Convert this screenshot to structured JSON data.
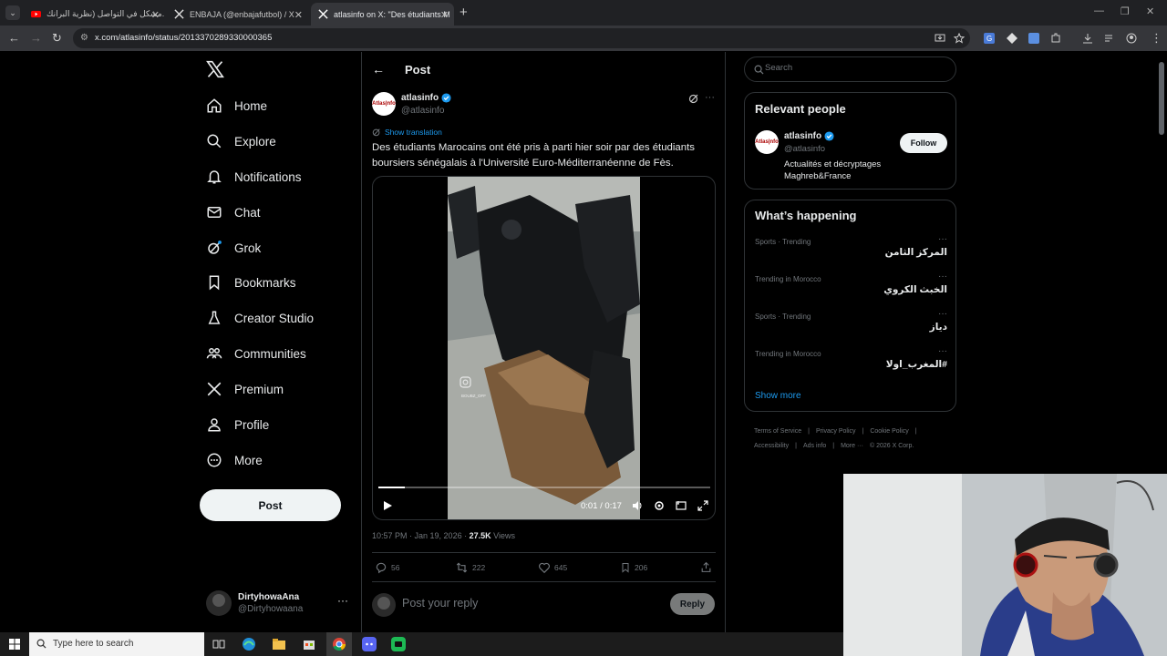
{
  "browser": {
    "tabs": [
      {
        "title": "مشكل في التواصل (نظرية البرانك...",
        "active": false
      },
      {
        "title": "ENBAJA (@enbajafutbol) / X",
        "active": false
      },
      {
        "title": "atlasinfo on X: \"Des étudiants M",
        "active": true
      }
    ],
    "url": "x.com/atlasinfo/status/2013370289330000365"
  },
  "sidebar": {
    "items": [
      {
        "label": "Home",
        "icon": "home-icon"
      },
      {
        "label": "Explore",
        "icon": "search-icon"
      },
      {
        "label": "Notifications",
        "icon": "bell-icon"
      },
      {
        "label": "Chat",
        "icon": "mail-icon"
      },
      {
        "label": "Grok",
        "icon": "grok-icon"
      },
      {
        "label": "Bookmarks",
        "icon": "bookmark-icon"
      },
      {
        "label": "Creator Studio",
        "icon": "flask-icon"
      },
      {
        "label": "Communities",
        "icon": "people-icon"
      },
      {
        "label": "Premium",
        "icon": "x-icon"
      },
      {
        "label": "Profile",
        "icon": "person-icon"
      },
      {
        "label": "More",
        "icon": "more-circle-icon"
      }
    ],
    "post_label": "Post",
    "account": {
      "name": "DirtyhowaAna",
      "handle": "@Dirtyhowaana"
    }
  },
  "post": {
    "header_title": "Post",
    "author": {
      "name": "atlasinfo",
      "handle": "@atlasinfo",
      "avatar_text": "Atlas|nfo"
    },
    "show_translation": "Show translation",
    "text": "Des étudiants Marocains ont été pris à parti hier soir par des étudiants boursiers sénégalais à l'Université Euro-Méditerranéenne de Fès.",
    "video": {
      "time": "0:01 / 0:17",
      "progress": 0.08,
      "watermark": "BOUBZ_OFF"
    },
    "meta": {
      "time": "10:57 PM",
      "date": "Jan 19, 2026",
      "views": "27.5K",
      "views_label": "Views"
    },
    "actions": {
      "replies": "56",
      "reposts": "222",
      "likes": "645",
      "bookmarks": "206"
    },
    "reply_placeholder": "Post your reply",
    "reply_button": "Reply"
  },
  "right": {
    "search_placeholder": "Search",
    "relevant": {
      "title": "Relevant people",
      "name": "atlasinfo",
      "handle": "@atlasinfo",
      "bio": "Actualités et décryptages Maghreb&France",
      "follow": "Follow"
    },
    "happening": {
      "title": "What’s happening",
      "trends": [
        {
          "context": "Sports · Trending",
          "name": "المركز الثامن"
        },
        {
          "context": "Trending in Morocco",
          "name": "الخبث الكروي"
        },
        {
          "context": "Sports · Trending",
          "name": "دياز"
        },
        {
          "context": "Trending in Morocco",
          "name": "#المغرب_اولا"
        }
      ],
      "show_more": "Show more"
    },
    "footer": [
      "Terms of Service",
      "|",
      "Privacy Policy",
      "|",
      "Cookie Policy",
      "|",
      "Accessibility",
      "|",
      "Ads info",
      "|",
      "More ···",
      "© 2026 X Corp."
    ]
  },
  "taskbar": {
    "search_placeholder": "Type here to search"
  },
  "colors": {
    "accent": "#1d9bf0",
    "bg": "#000000",
    "border": "#2f3336",
    "muted": "#71767b"
  }
}
